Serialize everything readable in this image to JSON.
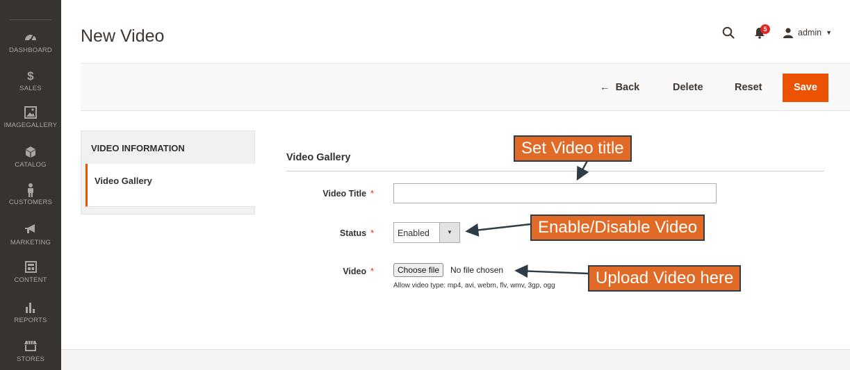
{
  "page": {
    "title": "New Video"
  },
  "sidebar": {
    "items": [
      {
        "label": "DASHBOARD",
        "icon": "dashboard-icon"
      },
      {
        "label": "SALES",
        "icon": "dollar-icon"
      },
      {
        "label": "IMAGEGALLERY",
        "icon": "image-icon"
      },
      {
        "label": "CATALOG",
        "icon": "cube-icon"
      },
      {
        "label": "CUSTOMERS",
        "icon": "person-icon"
      },
      {
        "label": "MARKETING",
        "icon": "megaphone-icon"
      },
      {
        "label": "CONTENT",
        "icon": "layout-icon"
      },
      {
        "label": "REPORTS",
        "icon": "bar-chart-icon"
      },
      {
        "label": "STORES",
        "icon": "store-icon"
      }
    ]
  },
  "header": {
    "notification_count": "5",
    "user": "admin"
  },
  "actions": {
    "back": "Back",
    "delete": "Delete",
    "reset": "Reset",
    "save": "Save"
  },
  "tabs": {
    "title": "VIDEO INFORMATION",
    "active": "Video Gallery"
  },
  "form": {
    "section_title": "Video Gallery",
    "video_title_label": "Video Title",
    "video_title_value": "",
    "status_label": "Status",
    "status_value": "Enabled",
    "video_label": "Video",
    "choose_file": "Choose file",
    "no_file": "No file chosen",
    "hint": "Allow video type: mp4, avi, webm, flv, wmv, 3gp, ogg",
    "required_mark": "*"
  },
  "annotations": {
    "title_callout": "Set Video title",
    "status_callout": "Enable/Disable Video",
    "upload_callout": "Upload Video here"
  },
  "colors": {
    "accent": "#eb5202",
    "sidebar": "#373330",
    "callout": "#e06a26",
    "required": "#e22626"
  }
}
